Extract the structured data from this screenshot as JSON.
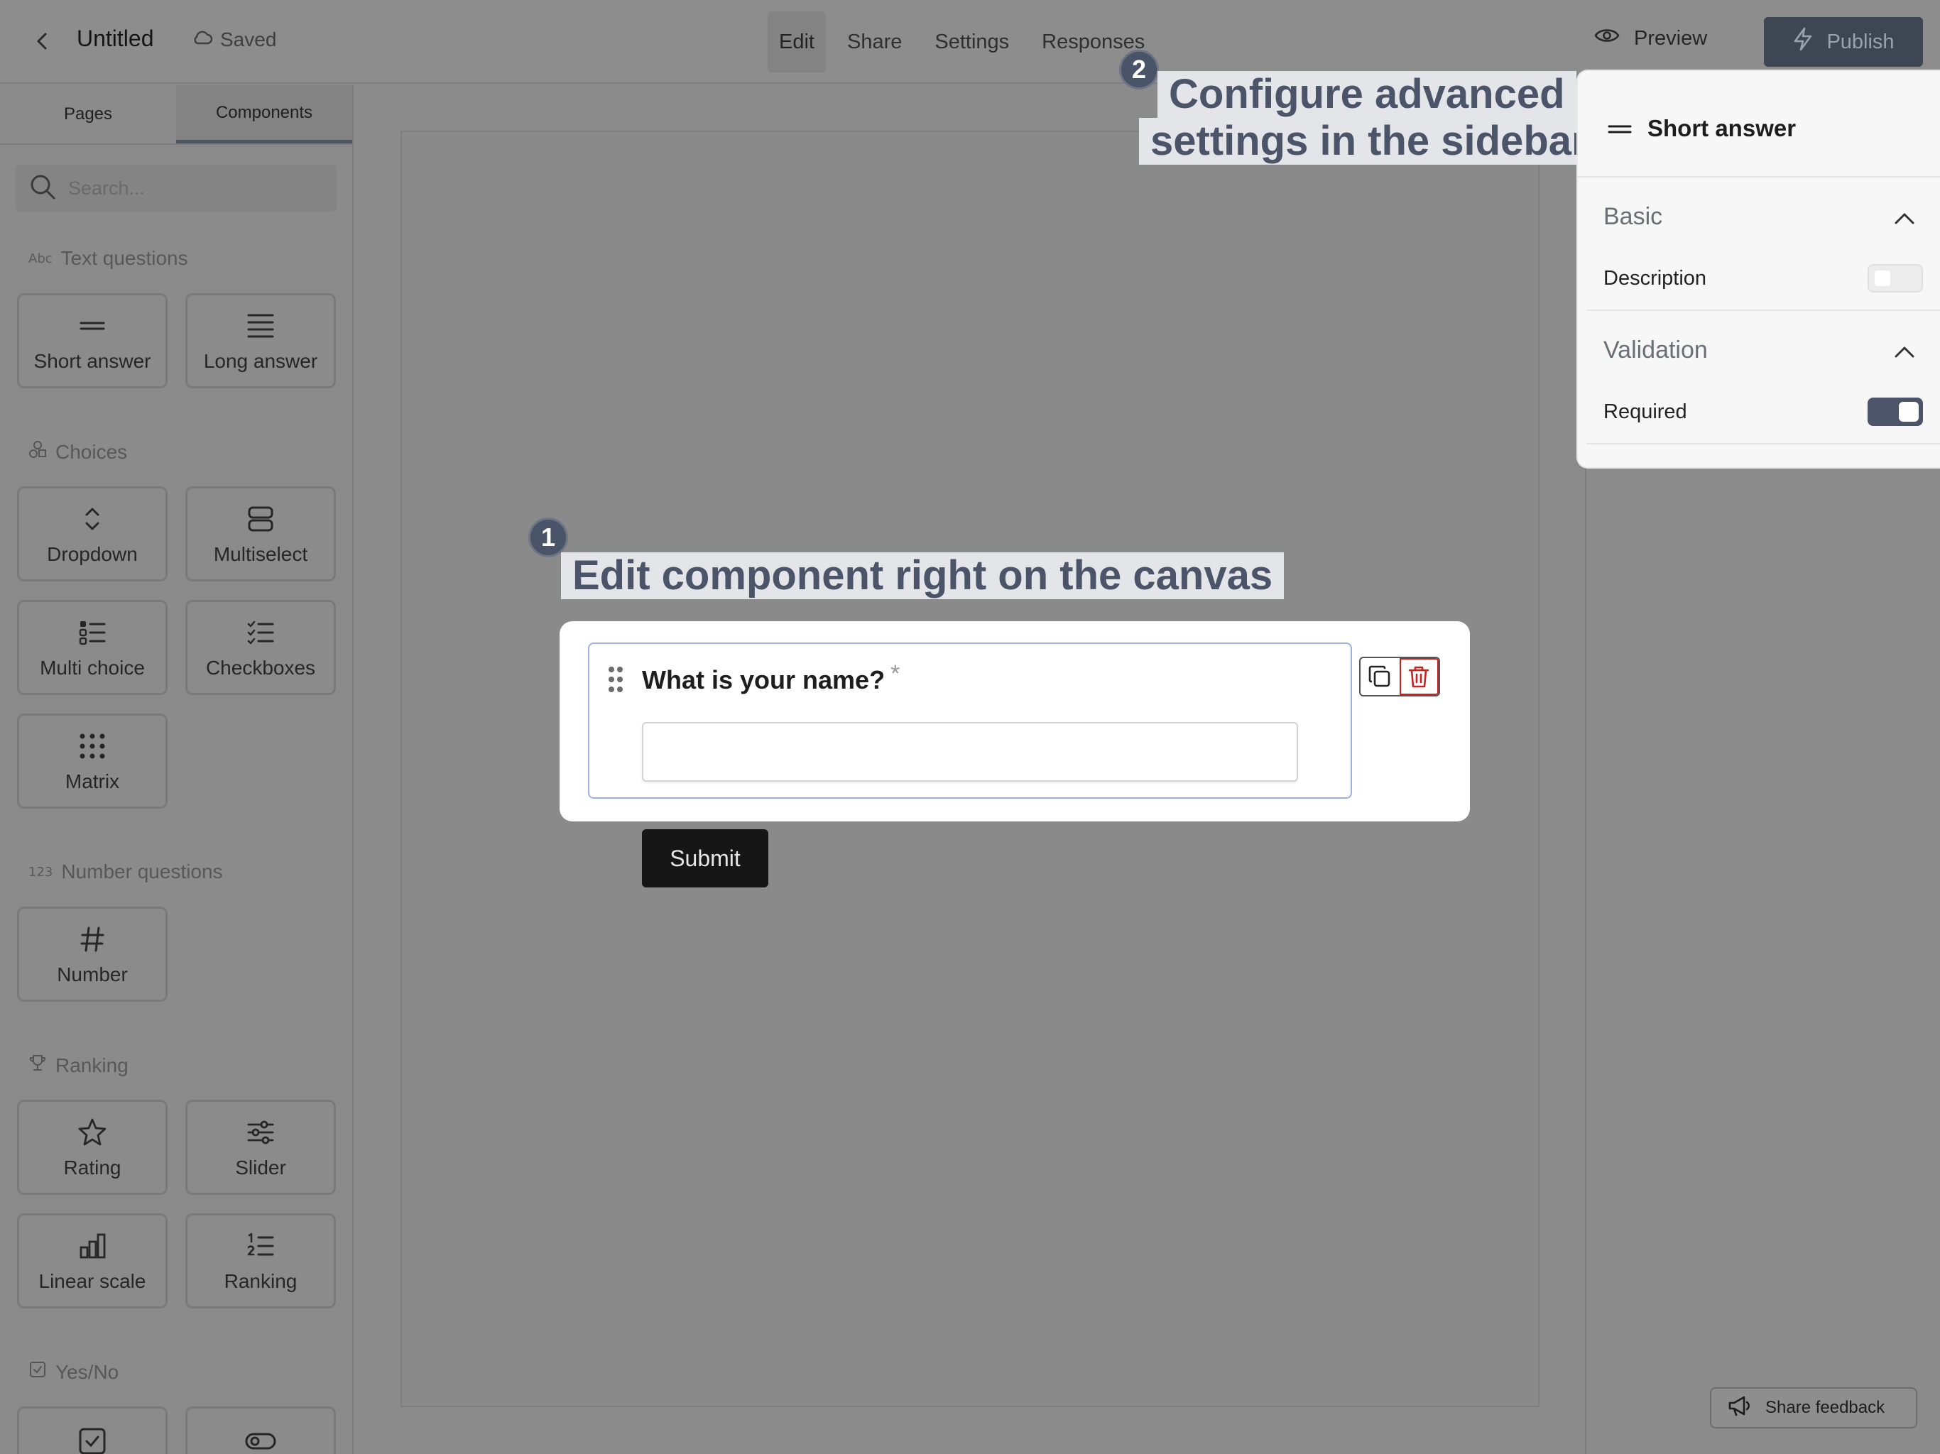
{
  "topbar": {
    "title": "Untitled",
    "saved": "Saved",
    "tabs": [
      "Edit",
      "Share",
      "Settings",
      "Responses"
    ],
    "active_tab": "Edit",
    "preview": "Preview",
    "publish": "Publish"
  },
  "sidebar": {
    "tabs": [
      "Pages",
      "Components"
    ],
    "active_tab": "Components",
    "search_placeholder": "Search...",
    "sections": {
      "text": {
        "title": "Text questions",
        "icon": "abc-icon",
        "items": [
          "Short answer",
          "Long answer"
        ]
      },
      "choices": {
        "title": "Choices",
        "icon": "shapes-icon",
        "items": [
          "Dropdown",
          "Multiselect",
          "Multi choice",
          "Checkboxes",
          "Matrix"
        ]
      },
      "number": {
        "title": "Number questions",
        "icon": "123-icon",
        "items": [
          "Number"
        ]
      },
      "ranking": {
        "title": "Ranking",
        "icon": "trophy-icon",
        "items": [
          "Rating",
          "Slider",
          "Linear scale",
          "Ranking"
        ]
      },
      "yesno": {
        "title": "Yes/No",
        "icon": "checkbox-icon",
        "items": []
      }
    },
    "small_labels": {
      "abc": "Abc",
      "num": "123"
    }
  },
  "canvas": {
    "question": "What is your name?",
    "required_mark": "*",
    "submit": "Submit"
  },
  "callouts": {
    "one": {
      "number": "1",
      "text": "Edit component right on the canvas"
    },
    "two": {
      "number": "2",
      "line1": "Configure advanced",
      "line2": "settings in the sidebar"
    }
  },
  "panel": {
    "title": "Short answer",
    "basic": "Basic",
    "description": "Description",
    "description_on": false,
    "validation": "Validation",
    "required": "Required",
    "required_on": true
  },
  "feedback": "Share feedback",
  "colors": {
    "accent": "#4b5468",
    "publish_bg": "#3d4652",
    "delete": "#c52222"
  }
}
